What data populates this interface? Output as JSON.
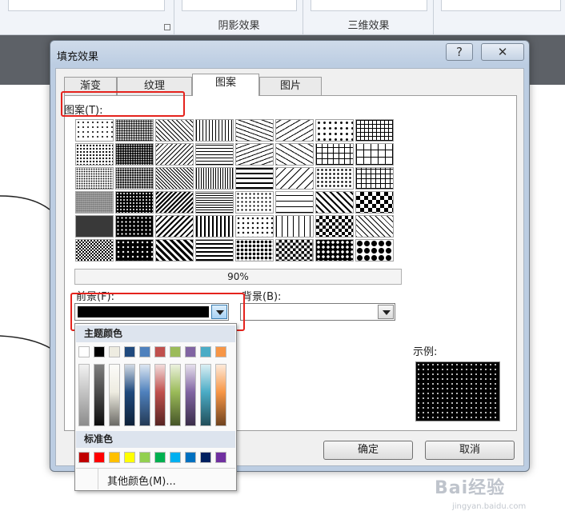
{
  "ribbon": {
    "groups": [
      {
        "label": ""
      },
      {
        "label": "阴影效果"
      },
      {
        "label": "三维效果"
      },
      {
        "label": ""
      }
    ]
  },
  "dialog": {
    "title": "填充效果",
    "help_glyph": "?",
    "close_glyph": "✕",
    "tabs": [
      {
        "label": "渐变",
        "active": false
      },
      {
        "label": "纹理",
        "active": false
      },
      {
        "label": "图案",
        "active": true
      },
      {
        "label": "图片",
        "active": false
      }
    ],
    "pattern_label": "图案(T):",
    "selected_pattern": "90%",
    "foreground_label": "前景(F):",
    "background_label": "背景(B):",
    "foreground_color": "#000000",
    "sample_label": "示例:",
    "ok_label": "确定",
    "cancel_label": "取消"
  },
  "color_picker": {
    "theme_header": "主题颜色",
    "theme_colors": [
      "#ffffff",
      "#000000",
      "#eeece1",
      "#1f497d",
      "#4f81bd",
      "#c0504d",
      "#9bbb59",
      "#8064a2",
      "#4bacc6",
      "#f79646"
    ],
    "standard_header": "标准色",
    "standard_colors": [
      "#c00000",
      "#ff0000",
      "#ffc000",
      "#ffff00",
      "#92d050",
      "#00b050",
      "#00b0f0",
      "#0070c0",
      "#002060",
      "#7030a0"
    ],
    "more_colors_label": "其他颜色(M)..."
  },
  "watermark": {
    "text": "Bai经验",
    "url": "jingyan.baidu.com"
  }
}
